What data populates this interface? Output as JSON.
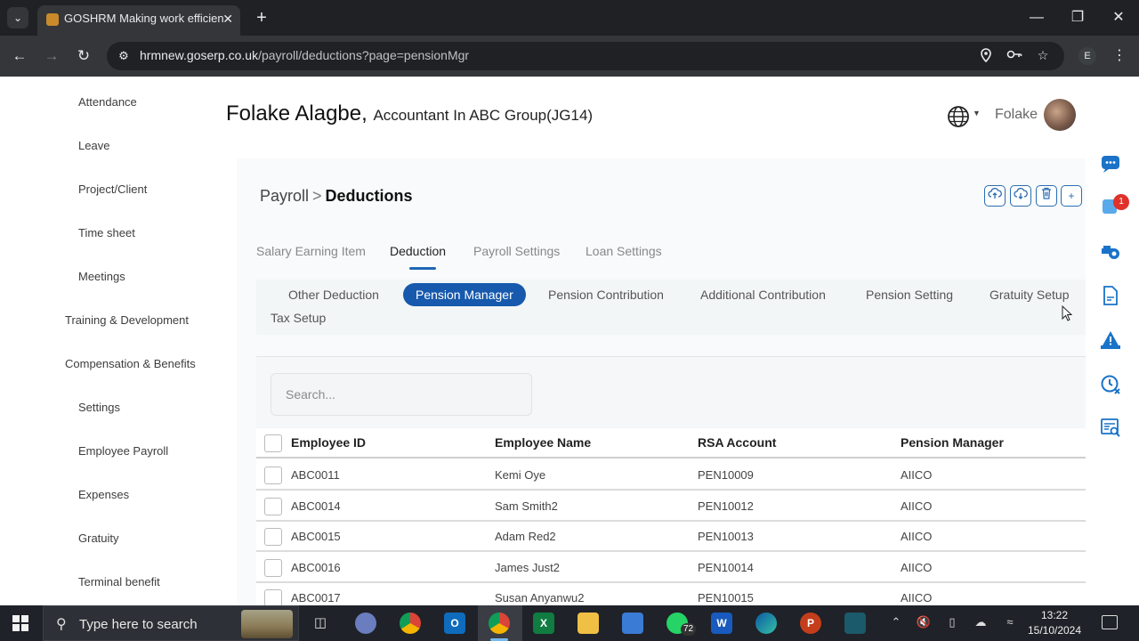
{
  "browser": {
    "tab_title": "GOSHRM Making work efficien",
    "url_host": "hrmnew.goserp.co.uk",
    "url_path": "/payroll/deductions?page=pensionMgr",
    "profile_initial": "E"
  },
  "sidebar": {
    "items": [
      {
        "label": "Attendance"
      },
      {
        "label": "Leave"
      },
      {
        "label": "Project/Client"
      },
      {
        "label": "Time sheet"
      },
      {
        "label": "Meetings"
      },
      {
        "label": "Training & Development"
      },
      {
        "label": "Compensation & Benefits"
      },
      {
        "label": "Settings"
      },
      {
        "label": "Employee Payroll"
      },
      {
        "label": "Expenses"
      },
      {
        "label": "Gratuity"
      },
      {
        "label": "Terminal benefit"
      }
    ]
  },
  "header": {
    "name": "Folake Alagbe,",
    "role": "Accountant In ABC Group(JG14)",
    "user_short": "Folake"
  },
  "breadcrumb": {
    "parent": "Payroll",
    "separator": ">",
    "current": "Deductions"
  },
  "actions": {
    "upload_icon": "cloud-upload-icon",
    "download_icon": "cloud-download-icon",
    "delete_icon": "trash-icon",
    "add_label": "+"
  },
  "main_tabs": [
    {
      "label": "Salary Earning Item"
    },
    {
      "label": "Deduction",
      "active": true
    },
    {
      "label": "Payroll Settings"
    },
    {
      "label": "Loan Settings"
    }
  ],
  "sub_tabs": [
    {
      "label": "Other Deduction"
    },
    {
      "label": "Pension Manager",
      "active": true
    },
    {
      "label": "Pension Contribution"
    },
    {
      "label": "Additional Contribution"
    },
    {
      "label": "Pension Setting"
    },
    {
      "label": "Gratuity Setup"
    },
    {
      "label": "Tax Setup"
    }
  ],
  "search": {
    "placeholder": "Search..."
  },
  "table": {
    "columns": [
      "Employee ID",
      "Employee Name",
      "RSA Account",
      "Pension Manager"
    ],
    "rows": [
      [
        "ABC0011",
        "Kemi Oye",
        "PEN10009",
        "AIICO"
      ],
      [
        "ABC0014",
        "Sam Smith2",
        "PEN10012",
        "AIICO"
      ],
      [
        "ABC0015",
        "Adam Red2",
        "PEN10013",
        "AIICO"
      ],
      [
        "ABC0016",
        "James Just2",
        "PEN10014",
        "AIICO"
      ],
      [
        "ABC0017",
        "Susan Anyanwu2",
        "PEN10015",
        "AIICO"
      ]
    ]
  },
  "right_rail": {
    "notification_count": "1"
  },
  "taskbar": {
    "search_text": "Type here to search",
    "whatsapp_badge": "72",
    "time": "13:22",
    "date": "15/10/2024"
  },
  "colors": {
    "accent": "#1659ad",
    "rail_icon": "#1a73c8",
    "badge": "#e0312b"
  }
}
